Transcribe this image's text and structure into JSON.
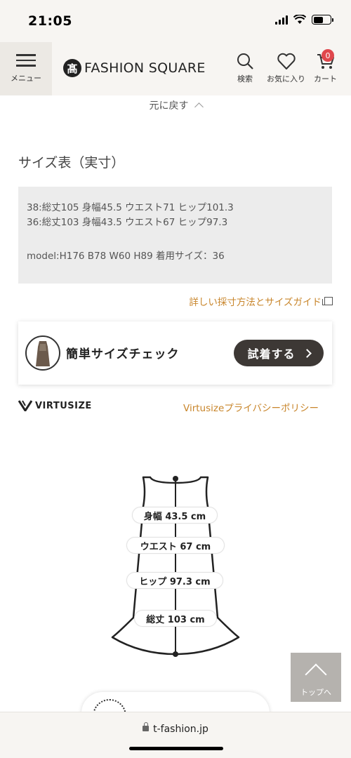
{
  "status": {
    "time": "21:05"
  },
  "header": {
    "menu_label": "メニュー",
    "brand_mark": "髙",
    "brand": "FASHION SQUARE",
    "search_label": "検索",
    "favorites_label": "お気に入り",
    "cart_label": "カート",
    "cart_count": "0"
  },
  "back_link": "元に戻す",
  "size_table": {
    "heading": "サイズ表（実寸）",
    "rows": [
      "38:総丈105 身幅45.5 ウエスト71 ヒップ101.3",
      "36:総丈103 身幅43.5 ウエスト67 ヒップ97.3"
    ],
    "model": "model:H176 B78 W60 H89 着用サイズ：36"
  },
  "guide_link": "詳しい採寸方法とサイズガイド",
  "virtusize": {
    "check_title": "簡単サイズチェック",
    "try_button": "試着する",
    "logo_text": "VIRTUSIZE",
    "privacy_link": "Virtusizeプライバシーポリシー"
  },
  "measurements": {
    "width": "身幅 43.5 cm",
    "waist": "ウエスト 67 cm",
    "hip": "ヒップ 97.3 cm",
    "length": "総丈 103 cm"
  },
  "top_button_label": "トップへ",
  "url": "t-fashion.jp",
  "colors": {
    "accent": "#c8852a",
    "badge": "#e0474c",
    "dark_button": "#3d3835"
  }
}
